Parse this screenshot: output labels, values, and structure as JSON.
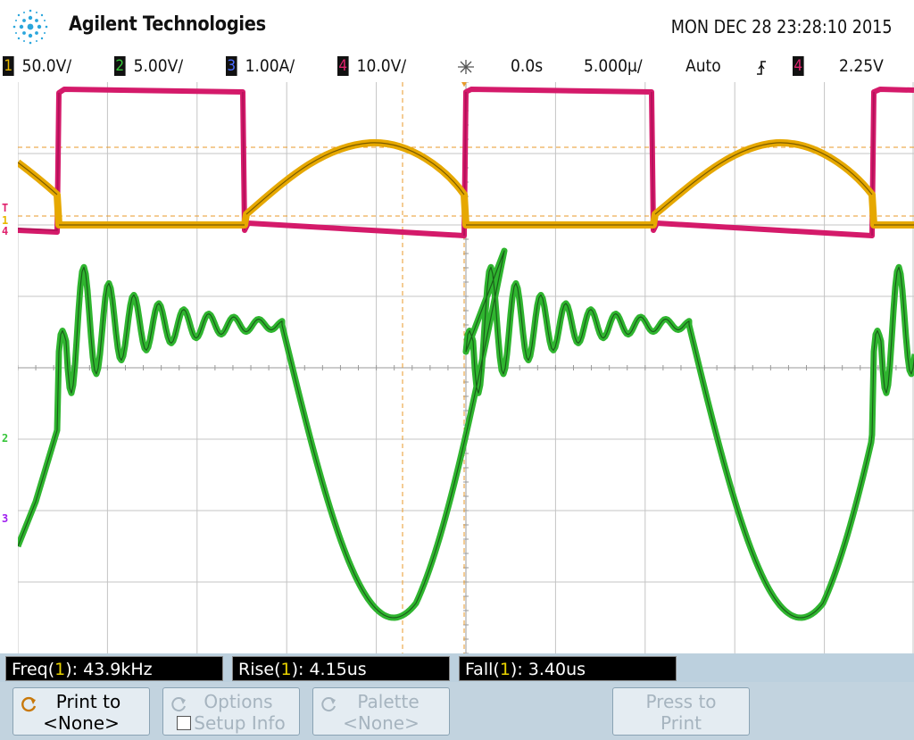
{
  "header": {
    "brand": "Agilent Technologies",
    "datetime": "MON DEC 28 23:28:10 2015"
  },
  "channels": [
    {
      "num": "1",
      "scale": "50.0V/",
      "color": "#e8b800"
    },
    {
      "num": "2",
      "scale": "5.00V/",
      "color": "#36c53a"
    },
    {
      "num": "3",
      "scale": "1.00A/",
      "color": "#4a6bff"
    },
    {
      "num": "4",
      "scale": "10.0V/",
      "color": "#e0236e"
    }
  ],
  "timebase": {
    "delay": "0.0s",
    "scale": "5.000µ/",
    "mode": "Auto",
    "trigger_source": "4",
    "trigger_level": "2.25V"
  },
  "ground_markers": {
    "trig": "T",
    "ch1": "1",
    "ch4": "4",
    "ch2": "2",
    "ch3": "3"
  },
  "measurements": [
    {
      "name": "Freq",
      "src": "1",
      "value": "43.9kHz"
    },
    {
      "name": "Rise",
      "src": "1",
      "value": "4.15us"
    },
    {
      "name": "Fall",
      "src": "1",
      "value": "3.40us"
    }
  ],
  "softkeys": [
    {
      "line1": "Print to",
      "line2": "<None>"
    },
    {
      "line1": "Options",
      "line2": "Setup Info"
    },
    {
      "line1": "Palette",
      "line2": "<None>"
    },
    {
      "line1": "Press to",
      "line2": "Print"
    }
  ],
  "icons": {
    "logo": "spark-logo-icon",
    "trigger": "trigger-edge-icon",
    "acquire": "acquire-icon",
    "print": "refresh-icon"
  }
}
